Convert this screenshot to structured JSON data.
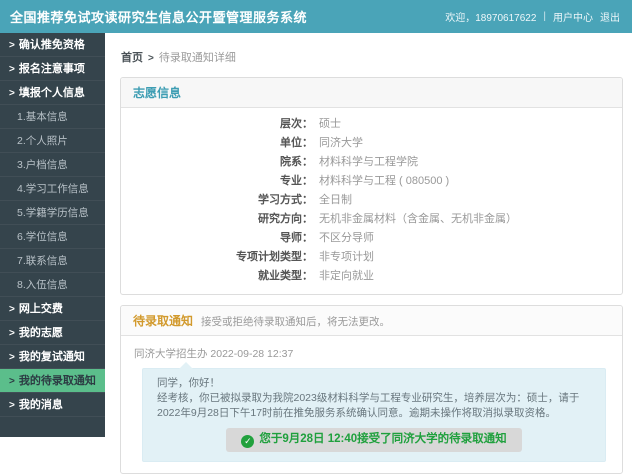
{
  "colors": {
    "header_teal": "#4AA4B8",
    "sidebar_dark": "#35444C",
    "active_green": "#5BBE8B",
    "panel_title_teal": "#3D9DB3",
    "notice_title_gold": "#D29A2D",
    "accepted_green": "#1FA03D",
    "bubble_blue": "#E2F1F6"
  },
  "icons": {
    "chevron": ">",
    "breadcrumb_sep": ">",
    "check": "✓"
  },
  "header": {
    "title": "全国推荐免试攻读研究生信息公开暨管理服务系统",
    "welcome": "欢迎，18970617622",
    "separator": "|",
    "user_center": "用户中心",
    "logout": "退出"
  },
  "sidebar": {
    "items": [
      {
        "label": "确认推免资格"
      },
      {
        "label": "报名注意事项"
      },
      {
        "label": "填报个人信息"
      },
      {
        "label": "1.基本信息"
      },
      {
        "label": "2.个人照片"
      },
      {
        "label": "3.户档信息"
      },
      {
        "label": "4.学习工作信息"
      },
      {
        "label": "5.学籍学历信息"
      },
      {
        "label": "6.学位信息"
      },
      {
        "label": "7.联系信息"
      },
      {
        "label": "8.入伍信息"
      },
      {
        "label": "网上交费"
      },
      {
        "label": "我的志愿"
      },
      {
        "label": "我的复试通知"
      },
      {
        "label": "我的待录取通知"
      },
      {
        "label": "我的消息"
      }
    ]
  },
  "breadcrumb": {
    "home": "首页",
    "current": "待录取通知详细"
  },
  "volunteer_panel": {
    "title": "志愿信息",
    "fields": [
      {
        "label": "层次：",
        "value": "硕士"
      },
      {
        "label": "单位：",
        "value": "同济大学"
      },
      {
        "label": "院系：",
        "value": "材料科学与工程学院"
      },
      {
        "label": "专业：",
        "value": "材料科学与工程 ( 080500 )"
      },
      {
        "label": "学习方式：",
        "value": "全日制"
      },
      {
        "label": "研究方向：",
        "value": "无机非金属材料（含金属、无机非金属）"
      },
      {
        "label": "导师：",
        "value": "不区分导师"
      },
      {
        "label": "专项计划类型：",
        "value": "非专项计划"
      },
      {
        "label": "就业类型：",
        "value": "非定向就业"
      }
    ]
  },
  "notice_panel": {
    "title": "待录取通知",
    "hint": "接受或拒绝待录取通知后，将无法更改。",
    "sender": "同济大学招生办 2022-09-28 12:37",
    "message_line1": "同学，你好！",
    "message_line2": "经考核，你已被拟录取为我院2023级材料科学与工程专业研究生，培养层次为：硕士，请于2022年9月28日下午17时前在推免服务系统确认同意。逾期未操作将取消拟录取资格。",
    "accepted_text": "您于9月28日 12:40接受了同济大学的待录取通知"
  }
}
